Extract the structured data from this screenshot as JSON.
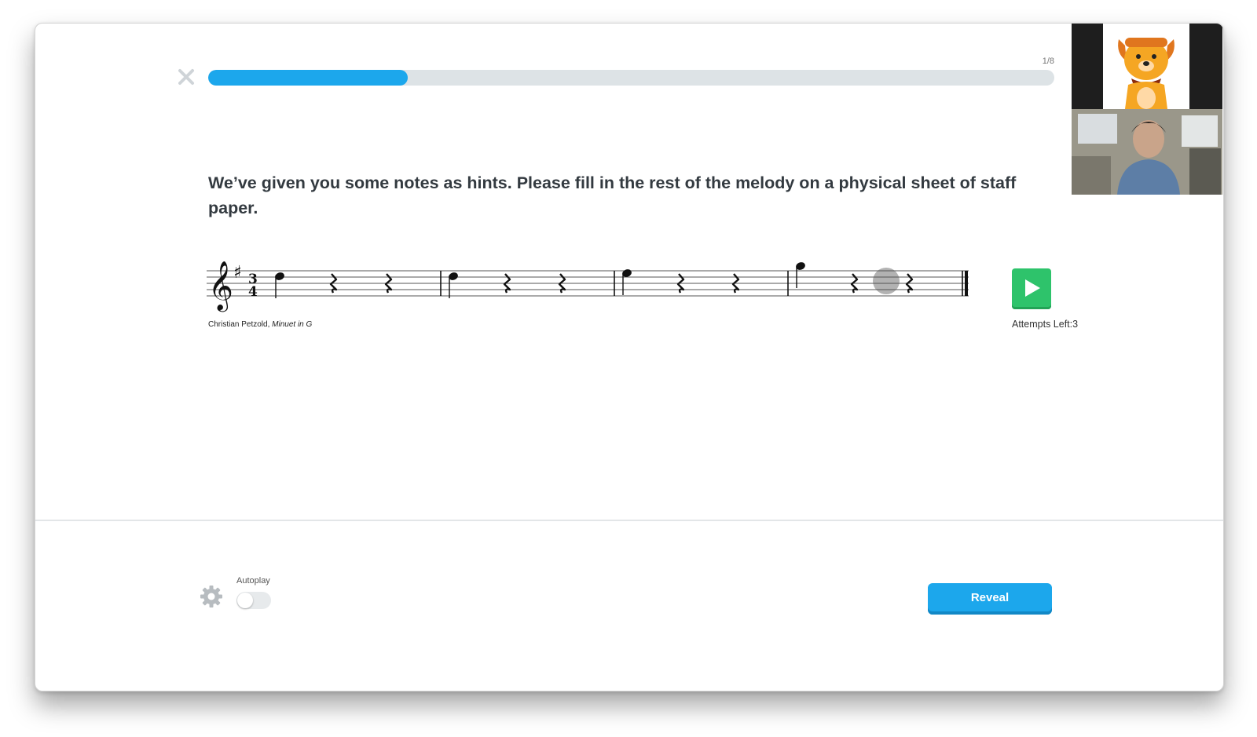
{
  "lesson": {
    "progress_text": "1/8",
    "progress_fraction": 0.236
  },
  "prompt": {
    "text": "We’ve given you some notes as hints. Please fill in the rest of the melody on a physical sheet of staff paper."
  },
  "score": {
    "composer": "Christian Petzold,",
    "piece": "Minuet in G",
    "time_signature_top": "3",
    "time_signature_bottom": "4",
    "key_signature": "♯",
    "measures": 4
  },
  "player": {
    "attempts_text": "Attempts Left:3",
    "play_icon": "play-icon"
  },
  "footer": {
    "autoplay_label": "Autoplay",
    "autoplay_on": false,
    "reveal_label": "Reveal",
    "settings_icon": "gear-icon"
  },
  "colors": {
    "accent": "#1ca7ec",
    "play": "#2ec36b",
    "text": "#333a40"
  }
}
